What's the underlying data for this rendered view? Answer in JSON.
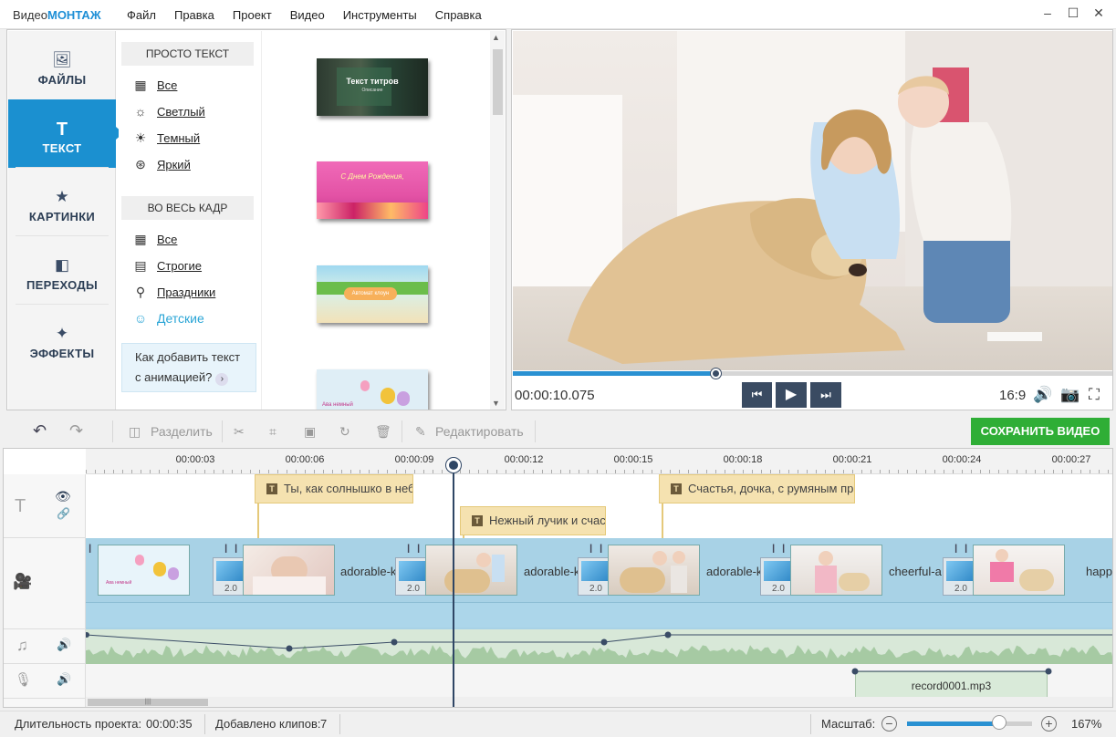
{
  "app": {
    "title_prefix": "Видео",
    "title_brand": "МОНТАЖ"
  },
  "menu": [
    "Файл",
    "Правка",
    "Проект",
    "Видео",
    "Инструменты",
    "Справка"
  ],
  "window_controls": {
    "minimize": "–",
    "maximize": "☐",
    "close": "✕"
  },
  "sidebar": {
    "items": [
      {
        "label": "ФАЙЛЫ",
        "icon": "image-icon",
        "glyph": "🖼"
      },
      {
        "label": "ТЕКСТ",
        "icon": "text-icon",
        "glyph": "T",
        "active": true
      },
      {
        "label": "КАРТИНКИ",
        "icon": "star-icon",
        "glyph": "★"
      },
      {
        "label": "ПЕРЕХОДЫ",
        "icon": "transitions-icon",
        "glyph": "◧"
      },
      {
        "label": "ЭФФЕКТЫ",
        "icon": "magic-wand-icon",
        "glyph": "✦"
      }
    ]
  },
  "categories": {
    "group1": {
      "title": "ПРОСТО ТЕКСТ",
      "items": [
        {
          "label": "Все",
          "icon": "grid-icon",
          "glyph": "▦"
        },
        {
          "label": "Светлый",
          "icon": "sun-light-icon",
          "glyph": "☼"
        },
        {
          "label": "Темный",
          "icon": "sun-dark-icon",
          "glyph": "☀"
        },
        {
          "label": "Яркий",
          "icon": "color-circles-icon",
          "glyph": "⊛"
        }
      ]
    },
    "group2": {
      "title": "ВО ВЕСЬ КАДР",
      "items": [
        {
          "label": "Все",
          "icon": "grid-icon",
          "glyph": "▦"
        },
        {
          "label": "Строгие",
          "icon": "clapperboard-icon",
          "glyph": "▤"
        },
        {
          "label": "Праздники",
          "icon": "balloon-icon",
          "glyph": "⚲"
        },
        {
          "label": "Детские",
          "icon": "baby-icon",
          "glyph": "☺",
          "selected": true
        }
      ]
    },
    "howto": {
      "line1": "Как добавить текст",
      "line2": "с анимацией?",
      "arrow": "›"
    }
  },
  "thumbnails": [
    {
      "title": "Текст титров",
      "sub": "Описание"
    },
    {
      "title": "С Днем Рождения,",
      "sub": ""
    },
    {
      "title": "Автомат клоун",
      "sub": ""
    },
    {
      "title": "Ава немный",
      "sub": ""
    }
  ],
  "preview": {
    "timecode": "00:00:10.075",
    "progress": 0.34,
    "ratio": "16:9",
    "buttons": {
      "prev": "⏮",
      "play": "▶",
      "next": "⏭"
    },
    "icons": {
      "volume": "🔊",
      "snapshot": "📷",
      "fullscreen": "⛶"
    }
  },
  "toolbar": {
    "undo": "↶",
    "redo": "↷",
    "split_label": "Разделить",
    "edit_label": "Редактировать",
    "save_label": "СОХРАНИТЬ ВИДЕО",
    "icons": {
      "split": "◫",
      "cut": "✂",
      "crop": "⌗",
      "frame": "▣",
      "rotate": "↻",
      "delete": "🗑",
      "edit": "✎"
    }
  },
  "ruler": {
    "ticks": [
      "00:00:03",
      "00:00:06",
      "00:00:09",
      "00:00:12",
      "00:00:15",
      "00:00:18",
      "00:00:21",
      "00:00:24",
      "00:00:27"
    ]
  },
  "tracks": {
    "text_icons": {
      "text": "T",
      "eye": "👁",
      "link": "🔗"
    },
    "video_icon": "🎥",
    "music_icons": {
      "note": "♫",
      "volume": "🔊"
    },
    "voice_icons": {
      "mic": "🎙",
      "volume": "🔊"
    }
  },
  "captions": [
    {
      "text": "Ты, как солнышко в неб",
      "start": 6.1
    },
    {
      "text": "Нежный лучик и счас",
      "start": 11.1
    },
    {
      "text": "Счастья, дочка, с румяным при",
      "start": 16.4
    }
  ],
  "clips": [
    {
      "name": "",
      "thumb": "balloons"
    },
    {
      "name": "adorable-k",
      "thumb": "kids"
    },
    {
      "name": "adorable-k",
      "thumb": "dog"
    },
    {
      "name": "adorable-k",
      "thumb": "dog2"
    },
    {
      "name": "cheerful-a",
      "thumb": "girl"
    },
    {
      "name": "happy",
      "thumb": "girl2"
    }
  ],
  "transition_duration": "2.0",
  "voice_clip": {
    "name": "record0001.mp3"
  },
  "status": {
    "duration_label": "Длительность проекта:",
    "duration": "00:00:35",
    "clips_label": "Добавлено клипов:",
    "clips": "7",
    "zoom_label": "Масштаб:",
    "zoom_value": "167%",
    "zoom_level": 0.74,
    "minus": "−",
    "plus": "+"
  },
  "colors": {
    "accent": "#1b90d0",
    "save": "#2fae36",
    "dark": "#3a4b62"
  }
}
